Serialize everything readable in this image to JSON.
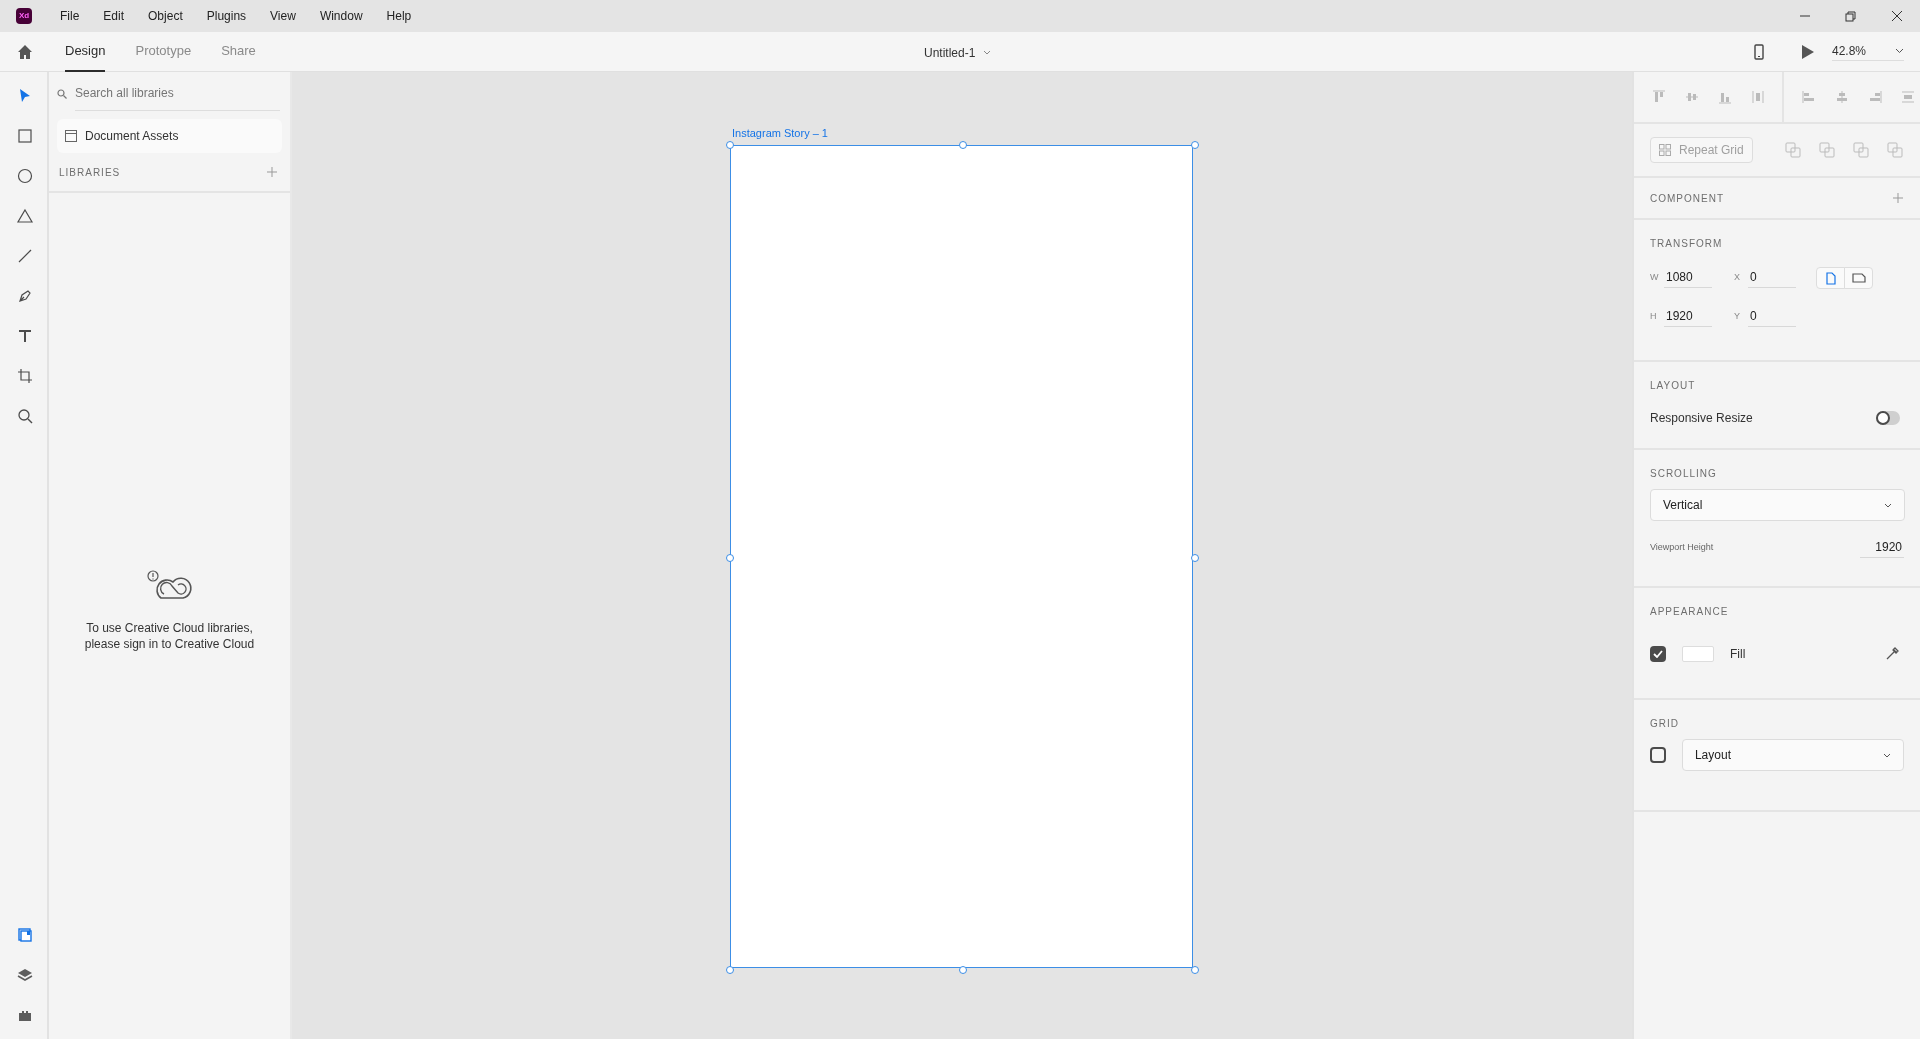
{
  "app": {
    "logo": "Xd"
  },
  "menu": [
    "File",
    "Edit",
    "Object",
    "Plugins",
    "View",
    "Window",
    "Help"
  ],
  "tabs": [
    {
      "label": "Design",
      "selected": true
    },
    {
      "label": "Prototype",
      "selected": false
    },
    {
      "label": "Share",
      "selected": false
    }
  ],
  "document": {
    "title": "Untitled-1"
  },
  "zoom": {
    "value": "42.8%"
  },
  "tools": [
    {
      "kind": "select",
      "selected": true
    },
    {
      "kind": "rectangle",
      "selected": false
    },
    {
      "kind": "ellipse",
      "selected": false
    },
    {
      "kind": "polygon",
      "selected": false
    },
    {
      "kind": "line",
      "selected": false
    },
    {
      "kind": "pen",
      "selected": false
    },
    {
      "kind": "text",
      "selected": false
    },
    {
      "kind": "artboard",
      "selected": false
    },
    {
      "kind": "zoom",
      "selected": false
    }
  ],
  "bottom_tools": [
    {
      "kind": "libraries",
      "selected": true
    },
    {
      "kind": "layers",
      "selected": false
    },
    {
      "kind": "plugins",
      "selected": false
    }
  ],
  "library_panel": {
    "search": {
      "placeholder": "Search all libraries"
    },
    "document_assets": "Document Assets",
    "libraries_heading": "LIBRARIES",
    "message": "To use Creative Cloud libraries, please sign in to Creative Cloud"
  },
  "artboard": {
    "title": "Instagram Story – 1",
    "selected": true
  },
  "inspector": {
    "repeat_grid": "Repeat Grid",
    "component_heading": "COMPONENT",
    "transform_heading": "TRANSFORM",
    "fields": [
      {
        "label": "W",
        "value": "1080"
      },
      {
        "label": "X",
        "value": "0"
      },
      {
        "label": "H",
        "value": "1920"
      },
      {
        "label": "Y",
        "value": "0"
      }
    ],
    "orientation": [
      {
        "kind": "portrait",
        "selected": true
      },
      {
        "kind": "landscape",
        "selected": false
      }
    ],
    "layout_heading": "LAYOUT",
    "responsive_resize": {
      "label": "Responsive Resize",
      "on": false
    },
    "scrolling_heading": "SCROLLING",
    "scrolling": {
      "value": "Vertical"
    },
    "viewport_height": {
      "label": "Viewport Height",
      "value": "1920"
    },
    "appearance_heading": "APPEARANCE",
    "fill": {
      "label": "Fill",
      "checked": true
    },
    "grid_heading": "GRID",
    "grid": {
      "checked": false,
      "value": "Layout"
    }
  }
}
